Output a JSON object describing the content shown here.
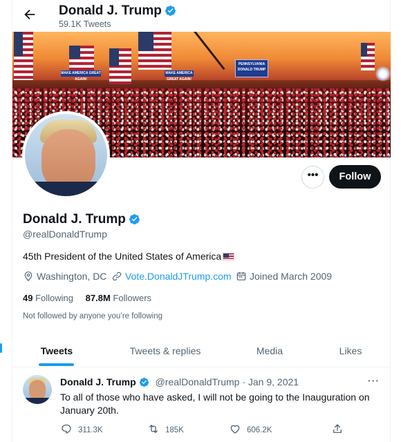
{
  "header": {
    "title": "Donald J. Trump",
    "tweet_count": "59.1K Tweets"
  },
  "banner": {
    "sign_texts": [
      "PENNSYLVANIA",
      "MAKE AMERICA GREAT AGAIN!",
      "DONALD TRUMP"
    ]
  },
  "actions": {
    "more_label": "•••",
    "follow_label": "Follow"
  },
  "profile": {
    "name": "Donald J. Trump",
    "handle": "@realDonaldTrump",
    "bio": "45th President of the United States of America",
    "location": "Washington, DC",
    "website": "Vote.DonaldJTrump.com",
    "joined": "Joined March 2009",
    "following_count": "49",
    "following_label": "Following",
    "followers_count": "87.8M",
    "followers_label": "Followers",
    "not_followed_text": "Not followed by anyone you’re following"
  },
  "tabs": [
    {
      "label": "Tweets",
      "active": true
    },
    {
      "label": "Tweets & replies",
      "active": false
    },
    {
      "label": "Media",
      "active": false
    },
    {
      "label": "Likes",
      "active": false
    }
  ],
  "tweet": {
    "name": "Donald J. Trump",
    "handle": "@realDonaldTrump",
    "separator": "·",
    "date": "Jan 9, 2021",
    "more": "···",
    "text": "To all of those who have asked, I will not be going to the Inauguration on January 20th.",
    "replies": "311.3K",
    "retweets": "185K",
    "likes": "606.2K"
  },
  "colors": {
    "accent": "#1d9bf0",
    "text": "#0f1419",
    "secondary": "#536471",
    "follow_bg": "#0f1419"
  },
  "icons": [
    "back-arrow-icon",
    "verified-badge-icon",
    "more-icon",
    "location-icon",
    "link-icon",
    "calendar-icon",
    "us-flag-emoji",
    "reply-icon",
    "retweet-icon",
    "like-icon",
    "share-icon"
  ]
}
